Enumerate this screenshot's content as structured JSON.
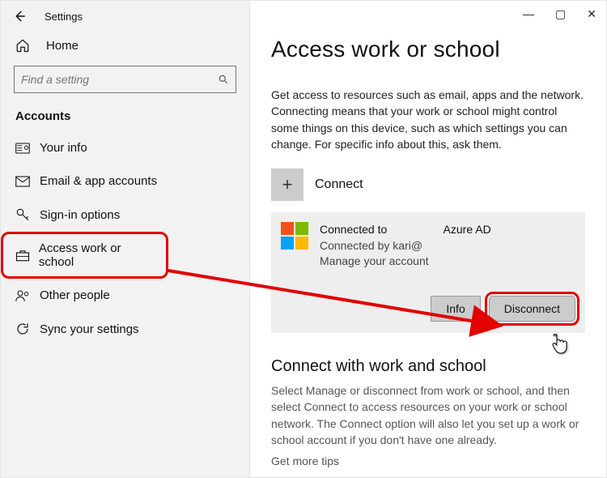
{
  "titlebar": {
    "label": "Settings"
  },
  "winbuttons": {
    "min": "—",
    "max": "▢",
    "close": "✕"
  },
  "home_label": "Home",
  "search": {
    "placeholder": "Find a setting"
  },
  "section_header": "Accounts",
  "sidebar": {
    "items": [
      {
        "icon": "id-card-icon",
        "label": "Your info"
      },
      {
        "icon": "mail-icon",
        "label": "Email & app accounts"
      },
      {
        "icon": "key-icon",
        "label": "Sign-in options"
      },
      {
        "icon": "briefcase-icon",
        "label": "Access work or school"
      },
      {
        "icon": "people-icon",
        "label": "Other people"
      },
      {
        "icon": "sync-icon",
        "label": "Sync your settings"
      }
    ]
  },
  "page": {
    "title": "Access work or school",
    "intro": "Get access to resources such as email, apps and the network. Connecting means that your work or school might control some things on this device, such as which settings you can change. For specific info about this, ask them.",
    "connect_label": "Connect",
    "account": {
      "line1_prefix": "Connected to",
      "line1_suffix": "Azure AD",
      "line2": "Connected by kari@",
      "line3": "Manage your account",
      "info_btn": "Info",
      "disconnect_btn": "Disconnect"
    },
    "section2_title": "Connect with work and school",
    "section2_body": "Select Manage or disconnect from work or school, and then select Connect to access resources on your work or school network. The Connect option will also let you set up a work or school account if you don't have one already.",
    "tips_link": "Get more tips"
  }
}
